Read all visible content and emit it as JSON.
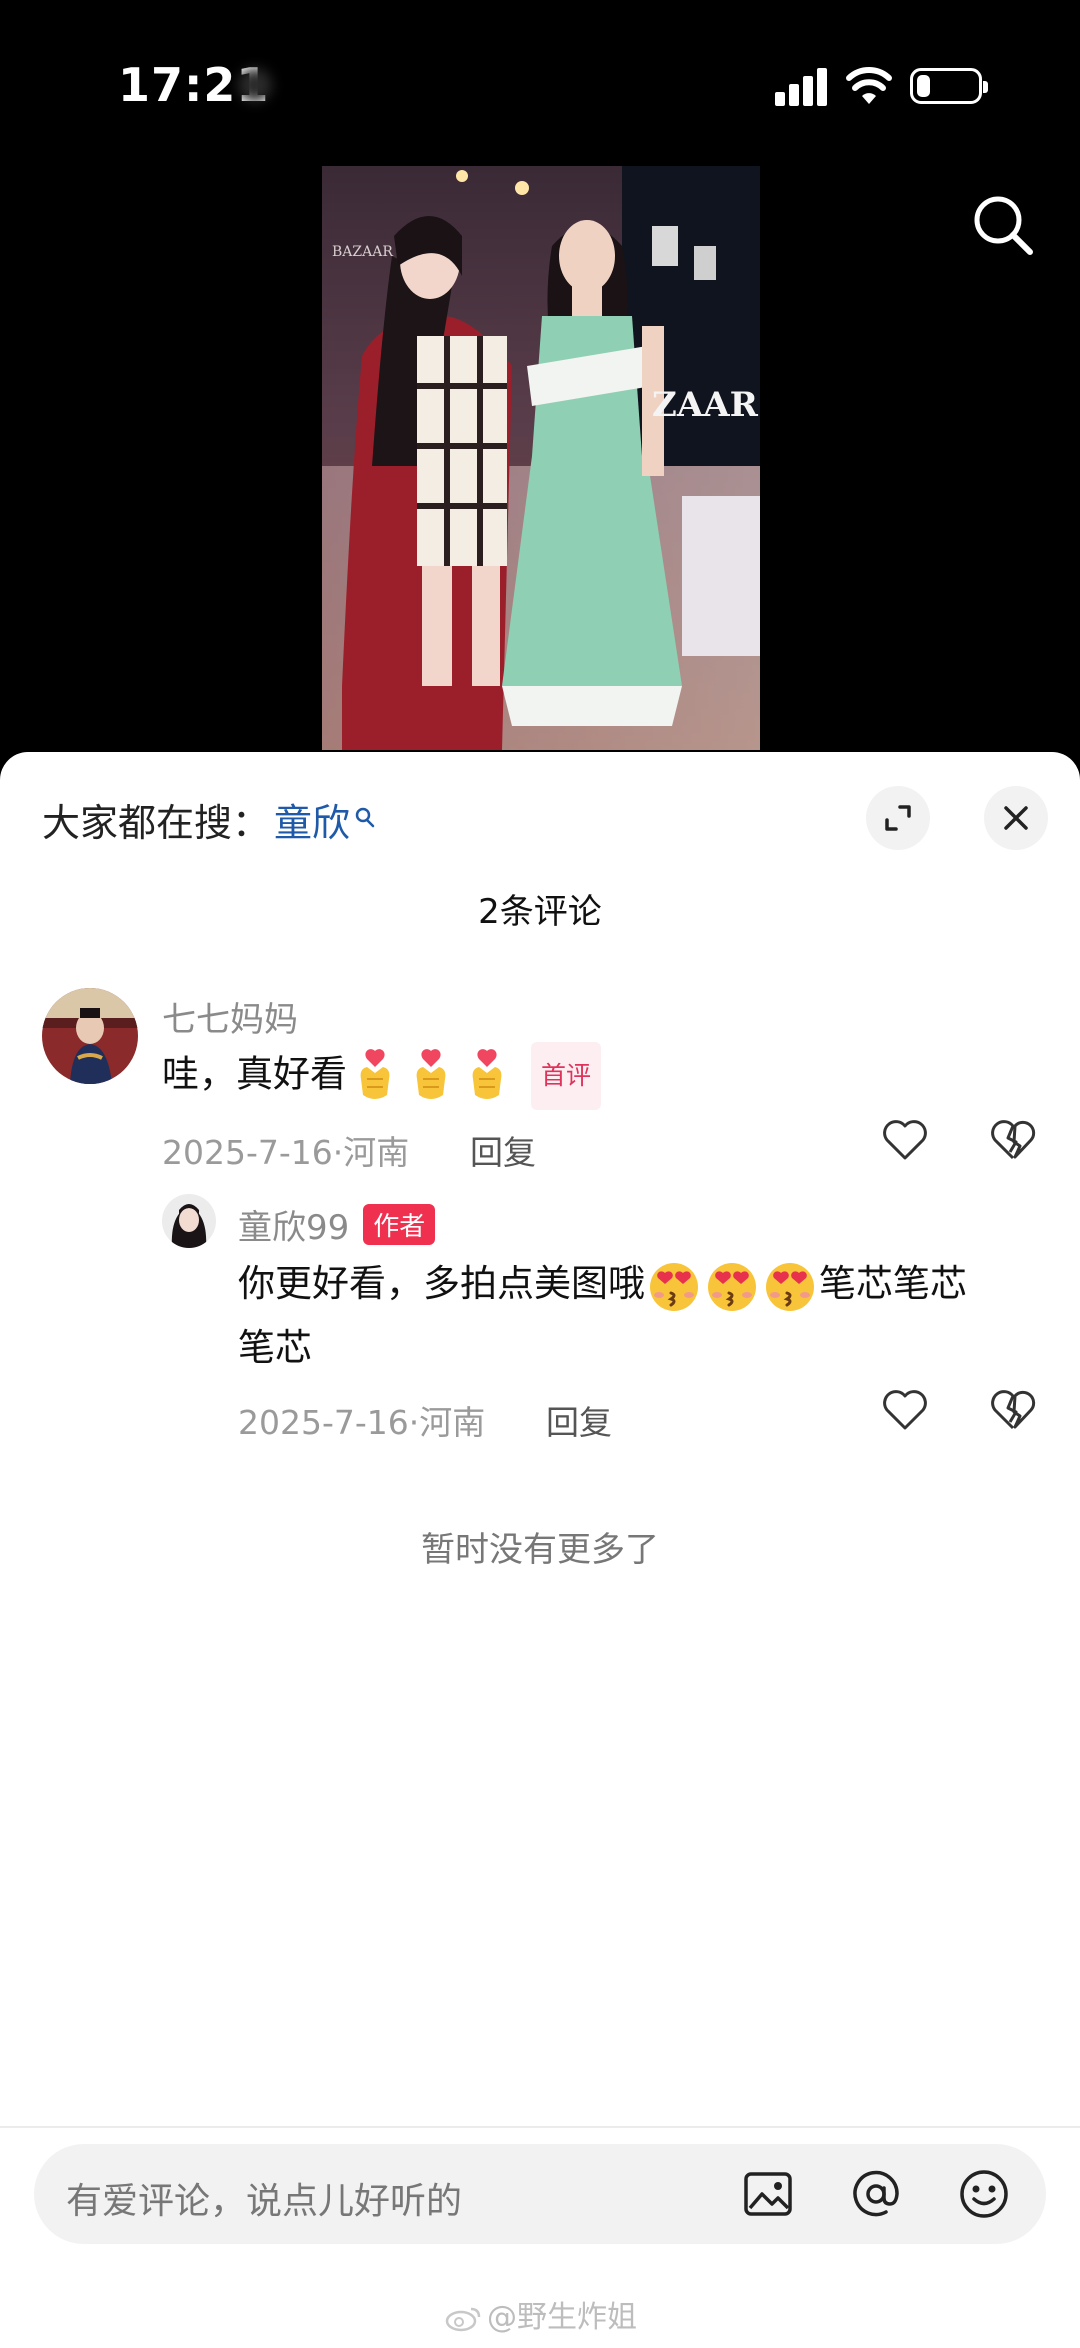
{
  "status_bar": {
    "time": "17:21",
    "battery_level": 0.22
  },
  "sheet": {
    "hot_search_prefix": "大家都在搜：",
    "hot_search_keyword": "童欣",
    "comment_count": "2条评论"
  },
  "comments": [
    {
      "username": "七七妈妈",
      "text": "哇，真好看",
      "emoji_name": "finger-heart-emoji",
      "emoji_count": 3,
      "badge": "首评",
      "date": "2025-7-16",
      "location": "河南",
      "reply_label": "回复",
      "replies": [
        {
          "username": "童欣99",
          "badge": "作者",
          "text_before": "你更好看，多拍点美图哦",
          "emoji_name": "heart-eyes-kiss-emoji",
          "emoji_count": 3,
          "text_after_line1": "笔芯笔芯",
          "text_line2": "笔芯",
          "date": "2025-7-16",
          "location": "河南",
          "reply_label": "回复"
        }
      ]
    }
  ],
  "footer_text": "暂时没有更多了",
  "input": {
    "placeholder": "有爱评论，说点儿好听的"
  },
  "watermark": "@野生炸姐",
  "icons": {
    "search": "search-icon",
    "expand": "expand-icon",
    "close": "close-icon",
    "like": "heart-icon",
    "dislike": "broken-heart-icon",
    "image": "image-icon",
    "mention": "at-icon",
    "emoji": "smiley-icon"
  }
}
